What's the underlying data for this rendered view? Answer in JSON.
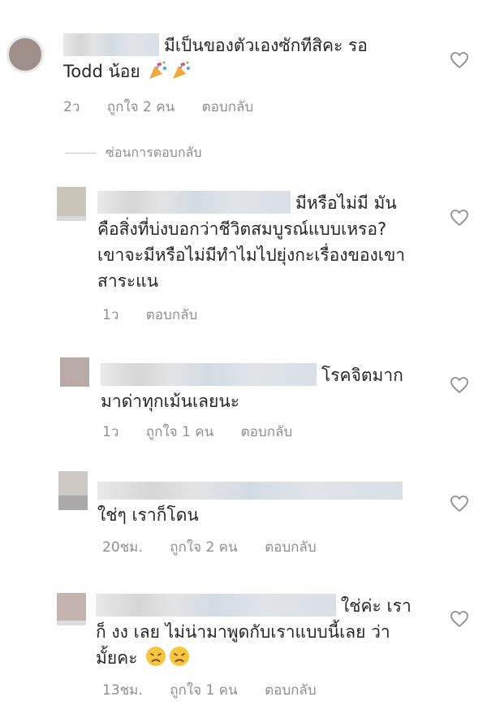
{
  "comments": [
    {
      "text_line1": "มีเป็นของตัวเองซักทีสิคะ รอ",
      "text_line2": "Todd น้อย",
      "emoji": [
        "party-popper",
        "party-popper"
      ],
      "time": "2ว",
      "likes": "ถูกใจ 2 คน",
      "reply": "ตอบกลับ"
    },
    {
      "text_line1": "มีหรือไม่มี  มัน",
      "text_line2": "คือสิ่งที่บ่งบอกว่าชีวิตสมบูรณ์แบบเหรอ?",
      "text_line3": "เขาจะมีหรือไม่มีทำไมไปยุ่งกะเรื่องของเขา",
      "text_line4": "สาระแน",
      "time": "1ว",
      "reply": "ตอบกลับ"
    },
    {
      "text_line1": "โรคจิตมาก",
      "text_line2": "มาด่าทุกเม้นเลยนะ",
      "time": "1ว",
      "likes": "ถูกใจ 1 คน",
      "reply": "ตอบกลับ"
    },
    {
      "text_line2": "ใช่ๆ เราก็โดน",
      "time": "20ชม.",
      "likes": "ถูกใจ 2 คน",
      "reply": "ตอบกลับ"
    },
    {
      "text_line1": "ใช่ค่ะ เรา",
      "text_line2": "ก็ งง เลย ไม่น่ามาพูดกับเราแบบนี้เลย ว่า",
      "text_line3": "มั้ยคะ",
      "emoji": [
        "disappointed-face",
        "disappointed-face"
      ],
      "time": "13ชม.",
      "likes": "ถูกใจ 1 คน",
      "reply": "ตอบกลับ"
    }
  ],
  "hide_replies_label": "ซ่อนการตอบกลับ",
  "colors": {
    "text": "#262626",
    "meta": "#8e8e8e",
    "heart": "#8e8e8e"
  }
}
